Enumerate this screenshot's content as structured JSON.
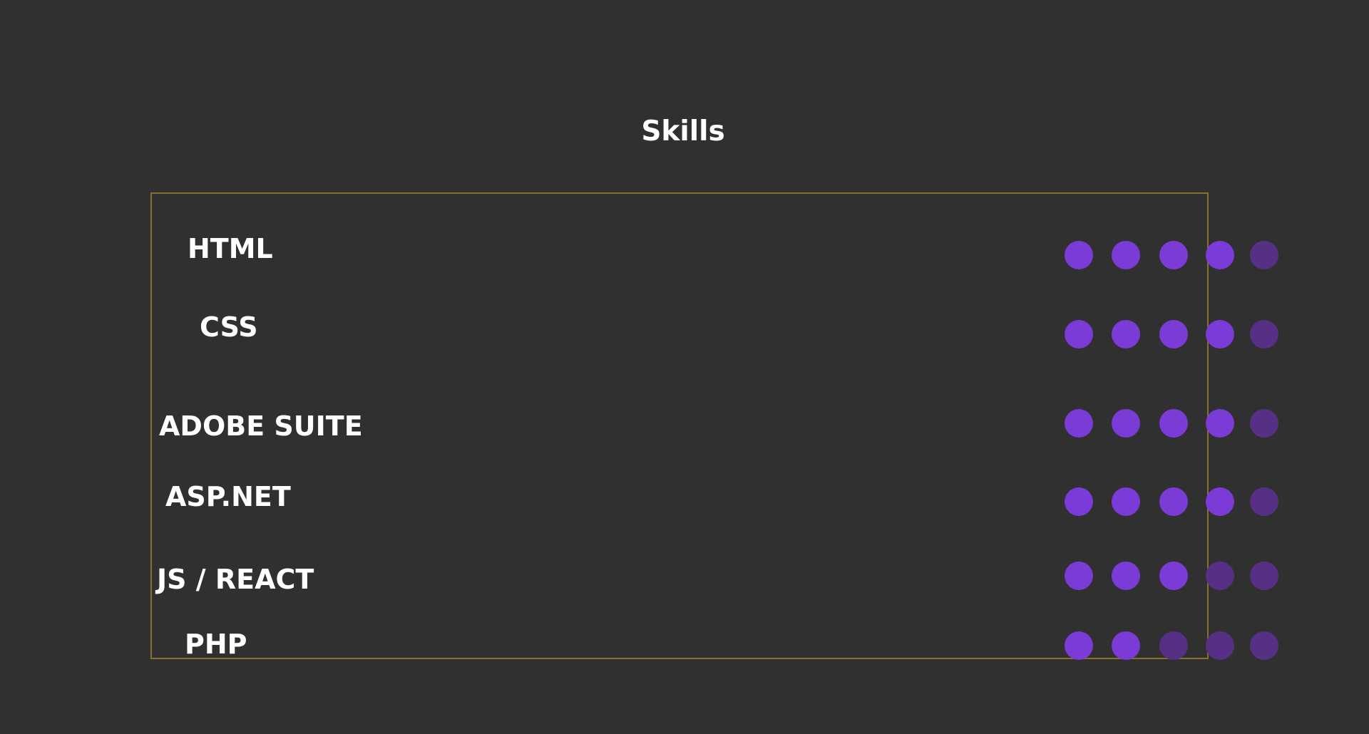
{
  "heading": "Skills",
  "colors": {
    "background": "#303030",
    "box_border": "#8a6f2a",
    "dot_filled": "#7b3bd6",
    "dot_empty": "#553085",
    "text": "#ffffff"
  },
  "rating_max": 5,
  "skills": [
    {
      "label": "HTML",
      "rating": 4
    },
    {
      "label": "CSS",
      "rating": 4
    },
    {
      "label": "ADOBE SUITE",
      "rating": 4
    },
    {
      "label": "ASP.NET",
      "rating": 4
    },
    {
      "label": "JS / REACT",
      "rating": 3
    },
    {
      "label": "PHP",
      "rating": 2
    }
  ]
}
